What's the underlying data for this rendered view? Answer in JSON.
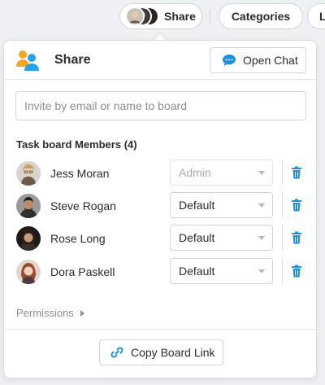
{
  "toolbar": {
    "share_label": "Share",
    "categories_label": "Categories",
    "next_label_partial": "L"
  },
  "popover": {
    "title": "Share",
    "open_chat_label": "Open Chat",
    "invite_placeholder": "Invite by email or name to board",
    "members_title": "Task board Members (4)",
    "members": [
      {
        "name": "Jess Moran",
        "role": "Admin",
        "role_disabled": true
      },
      {
        "name": "Steve Rogan",
        "role": "Default",
        "role_disabled": false
      },
      {
        "name": "Rose Long",
        "role": "Default",
        "role_disabled": false
      },
      {
        "name": "Dora Paskell",
        "role": "Default",
        "role_disabled": false
      }
    ],
    "permissions_label": "Permissions",
    "copy_link_label": "Copy Board Link"
  },
  "colors": {
    "accent_blue": "#1f8fe0",
    "share_icon_orange": "#f5a623",
    "share_icon_blue": "#29a3e8",
    "muted_text": "#8a8f96"
  },
  "icons": {
    "share": "people-icon",
    "chat": "chat-bubble-icon",
    "trash": "trash-icon",
    "link": "link-icon"
  }
}
